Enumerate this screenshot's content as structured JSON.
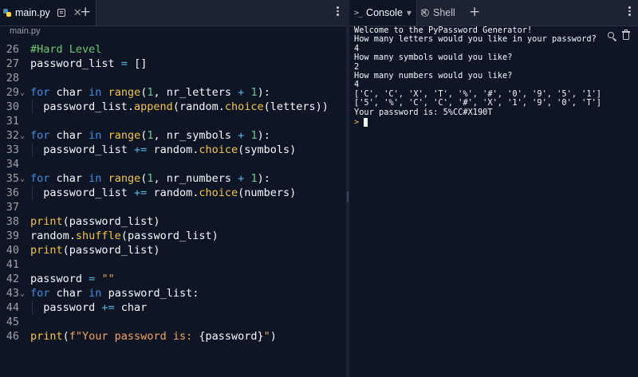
{
  "editor": {
    "tab_label": "main.py",
    "breadcrumb": "main.py",
    "lines": [
      {
        "n": "26",
        "fold": false,
        "indent": false,
        "tokens": [
          {
            "t": "#Hard Level",
            "c": "cm"
          }
        ]
      },
      {
        "n": "27",
        "fold": false,
        "indent": false,
        "tokens": [
          {
            "t": "password_list ",
            "c": ""
          },
          {
            "t": "=",
            "c": "op"
          },
          {
            "t": " []",
            "c": ""
          }
        ]
      },
      {
        "n": "28",
        "fold": false,
        "indent": false,
        "tokens": []
      },
      {
        "n": "29",
        "fold": true,
        "indent": false,
        "tokens": [
          {
            "t": "for",
            "c": "kw"
          },
          {
            "t": " char ",
            "c": ""
          },
          {
            "t": "in",
            "c": "kw"
          },
          {
            "t": " ",
            "c": ""
          },
          {
            "t": "range",
            "c": "fn"
          },
          {
            "t": "(",
            "c": ""
          },
          {
            "t": "1",
            "c": "num"
          },
          {
            "t": ", nr_letters ",
            "c": ""
          },
          {
            "t": "+",
            "c": "op"
          },
          {
            "t": " ",
            "c": ""
          },
          {
            "t": "1",
            "c": "num"
          },
          {
            "t": "):",
            "c": ""
          }
        ]
      },
      {
        "n": "30",
        "fold": false,
        "indent": true,
        "tokens": [
          {
            "t": "  password_list.",
            "c": ""
          },
          {
            "t": "append",
            "c": "fn"
          },
          {
            "t": "(random.",
            "c": ""
          },
          {
            "t": "choice",
            "c": "fn"
          },
          {
            "t": "(letters))",
            "c": ""
          }
        ]
      },
      {
        "n": "31",
        "fold": false,
        "indent": false,
        "tokens": []
      },
      {
        "n": "32",
        "fold": true,
        "indent": false,
        "tokens": [
          {
            "t": "for",
            "c": "kw"
          },
          {
            "t": " char ",
            "c": ""
          },
          {
            "t": "in",
            "c": "kw"
          },
          {
            "t": " ",
            "c": ""
          },
          {
            "t": "range",
            "c": "fn"
          },
          {
            "t": "(",
            "c": ""
          },
          {
            "t": "1",
            "c": "num"
          },
          {
            "t": ", nr_symbols ",
            "c": ""
          },
          {
            "t": "+",
            "c": "op"
          },
          {
            "t": " ",
            "c": ""
          },
          {
            "t": "1",
            "c": "num"
          },
          {
            "t": "):",
            "c": ""
          }
        ]
      },
      {
        "n": "33",
        "fold": false,
        "indent": true,
        "tokens": [
          {
            "t": "  password_list ",
            "c": ""
          },
          {
            "t": "+=",
            "c": "op"
          },
          {
            "t": " random.",
            "c": ""
          },
          {
            "t": "choice",
            "c": "fn"
          },
          {
            "t": "(symbols)",
            "c": ""
          }
        ]
      },
      {
        "n": "34",
        "fold": false,
        "indent": false,
        "tokens": []
      },
      {
        "n": "35",
        "fold": true,
        "indent": false,
        "tokens": [
          {
            "t": "for",
            "c": "kw"
          },
          {
            "t": " char ",
            "c": ""
          },
          {
            "t": "in",
            "c": "kw"
          },
          {
            "t": " ",
            "c": ""
          },
          {
            "t": "range",
            "c": "fn"
          },
          {
            "t": "(",
            "c": ""
          },
          {
            "t": "1",
            "c": "num"
          },
          {
            "t": ", nr_numbers ",
            "c": ""
          },
          {
            "t": "+",
            "c": "op"
          },
          {
            "t": " ",
            "c": ""
          },
          {
            "t": "1",
            "c": "num"
          },
          {
            "t": "):",
            "c": ""
          }
        ]
      },
      {
        "n": "36",
        "fold": false,
        "indent": true,
        "tokens": [
          {
            "t": "  password_list ",
            "c": ""
          },
          {
            "t": "+=",
            "c": "op"
          },
          {
            "t": " random.",
            "c": ""
          },
          {
            "t": "choice",
            "c": "fn"
          },
          {
            "t": "(numbers)",
            "c": ""
          }
        ]
      },
      {
        "n": "37",
        "fold": false,
        "indent": false,
        "tokens": []
      },
      {
        "n": "38",
        "fold": false,
        "indent": false,
        "tokens": [
          {
            "t": "print",
            "c": "fn"
          },
          {
            "t": "(password_list)",
            "c": ""
          }
        ]
      },
      {
        "n": "39",
        "fold": false,
        "indent": false,
        "tokens": [
          {
            "t": "random.",
            "c": ""
          },
          {
            "t": "shuffle",
            "c": "fn"
          },
          {
            "t": "(password_list)",
            "c": ""
          }
        ]
      },
      {
        "n": "40",
        "fold": false,
        "indent": false,
        "tokens": [
          {
            "t": "print",
            "c": "fn"
          },
          {
            "t": "(password_list)",
            "c": ""
          }
        ]
      },
      {
        "n": "41",
        "fold": false,
        "indent": false,
        "tokens": []
      },
      {
        "n": "42",
        "fold": false,
        "indent": false,
        "tokens": [
          {
            "t": "password ",
            "c": ""
          },
          {
            "t": "=",
            "c": "op"
          },
          {
            "t": " ",
            "c": ""
          },
          {
            "t": "\"\"",
            "c": "str"
          }
        ]
      },
      {
        "n": "43",
        "fold": true,
        "indent": false,
        "tokens": [
          {
            "t": "for",
            "c": "kw"
          },
          {
            "t": " char ",
            "c": ""
          },
          {
            "t": "in",
            "c": "kw"
          },
          {
            "t": " password_list:",
            "c": ""
          }
        ]
      },
      {
        "n": "44",
        "fold": false,
        "indent": true,
        "tokens": [
          {
            "t": "  password ",
            "c": ""
          },
          {
            "t": "+=",
            "c": "op"
          },
          {
            "t": " char",
            "c": ""
          }
        ]
      },
      {
        "n": "45",
        "fold": false,
        "indent": false,
        "tokens": []
      },
      {
        "n": "46",
        "fold": false,
        "indent": false,
        "tokens": [
          {
            "t": "print",
            "c": "fn"
          },
          {
            "t": "(",
            "c": ""
          },
          {
            "t": "f\"Your password is: ",
            "c": "str"
          },
          {
            "t": "{password}",
            "c": ""
          },
          {
            "t": "\"",
            "c": "str"
          },
          {
            "t": ")",
            "c": ""
          }
        ]
      }
    ]
  },
  "console": {
    "tab_label": "Console",
    "shell_tab_label": "Shell",
    "prompt_symbol": ">",
    "output": [
      "Welcome to the PyPassword Generator!",
      "How many letters would you like in your password?",
      "4",
      "How many symbols would you like?",
      "2",
      "How many numbers would you like?",
      "4",
      "['C', 'C', 'X', 'T', '%', '#', '0', '9', '5', '1']",
      "['5', '%', 'C', 'C', '#', 'X', '1', '9', '0', 'T']",
      "Your password is: 5%CC#X190T"
    ]
  },
  "icons": {
    "editor_tab": "python-file-icon",
    "console_tab": "terminal-prompt-icon",
    "shell_tab": "shell-icon"
  },
  "colors": {
    "keyword": "#3d8fe0",
    "function": "#f5c542",
    "number": "#73c990",
    "operator": "#58b8e0",
    "string": "#f5a35c",
    "comment": "#6ac96e",
    "background": "#0e1525"
  }
}
